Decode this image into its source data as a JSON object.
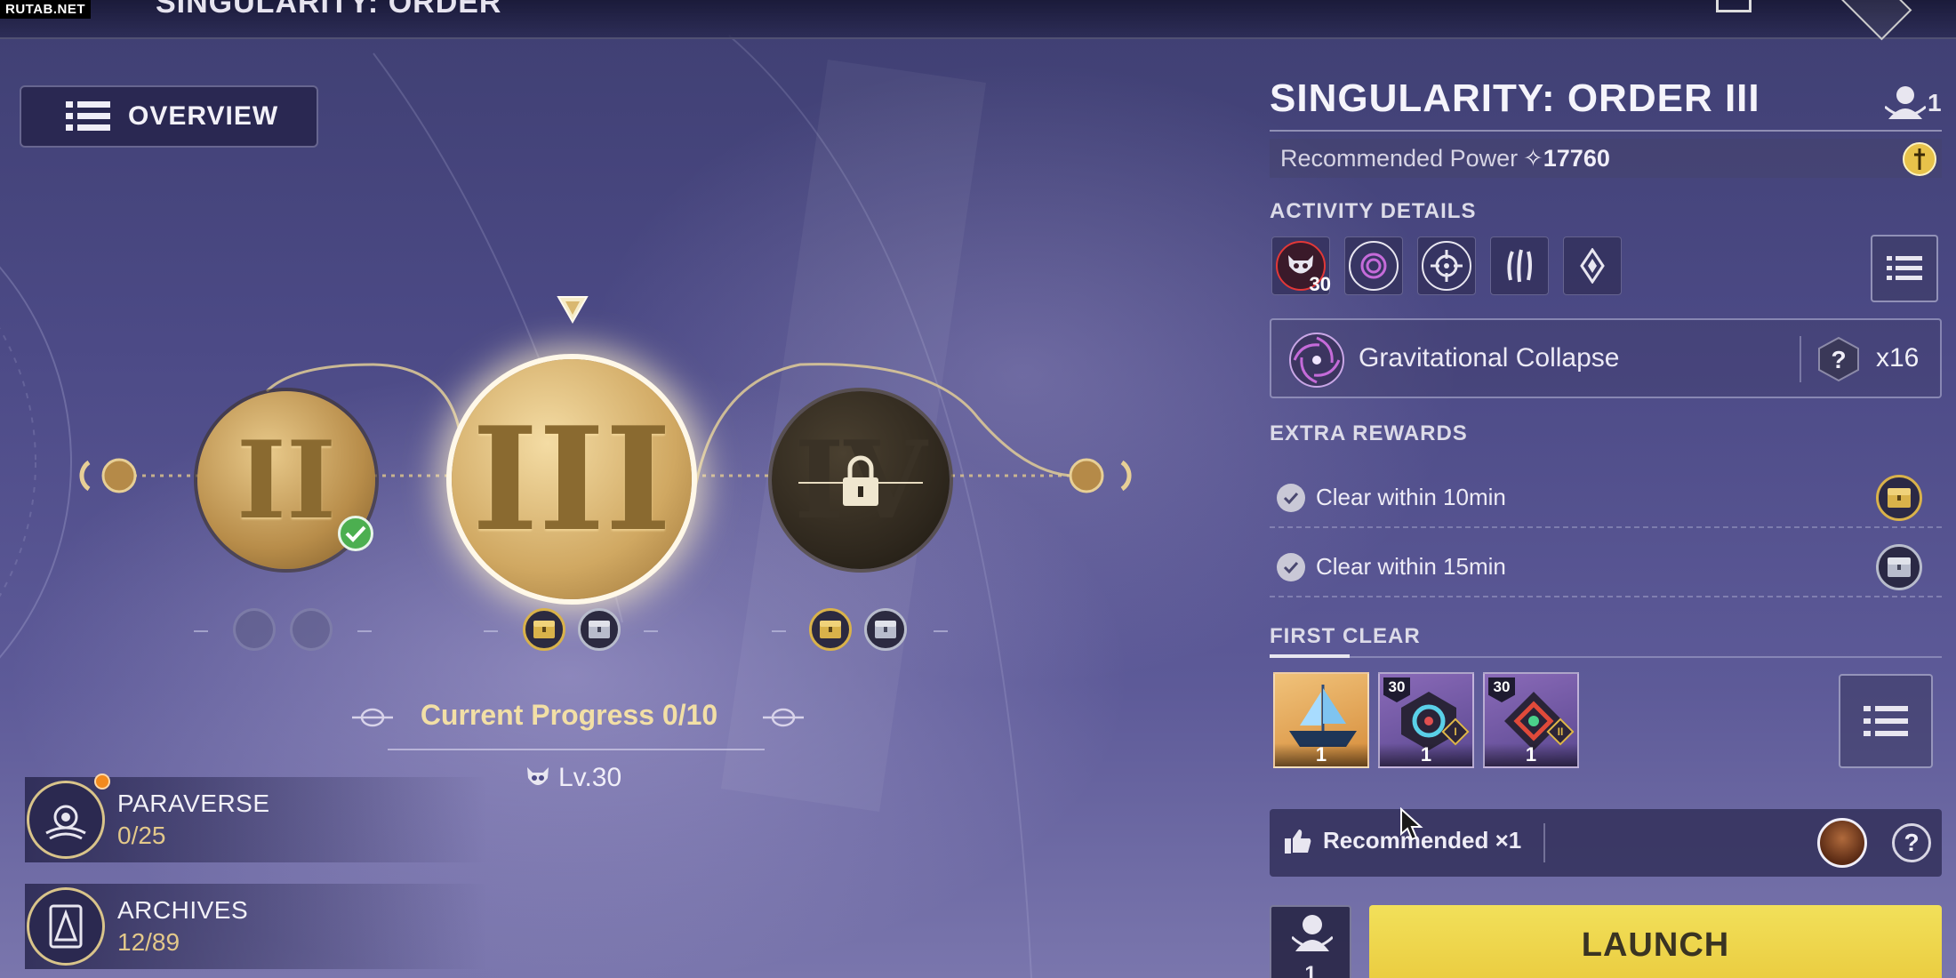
{
  "watermark": "RUTAB.NET",
  "top_bar": {
    "title": "SINGULARITY: ORDER"
  },
  "overview_button": {
    "label": "OVERVIEW"
  },
  "stages": [
    {
      "numeral": "II",
      "state": "cleared"
    },
    {
      "numeral": "III",
      "state": "selected"
    },
    {
      "numeral": "IV",
      "state": "locked"
    }
  ],
  "progress": {
    "label": "Current Progress 0/10",
    "level": "Lv.30"
  },
  "side_entries": [
    {
      "title": "PARAVERSE",
      "value": "0/25",
      "icon": "paraverse-icon"
    },
    {
      "title": "ARCHIVES",
      "value": "12/89",
      "icon": "archives-icon"
    }
  ],
  "panel": {
    "title": "SINGULARITY: ORDER III",
    "party_count": "1",
    "recommended_power_label": "Recommended Power",
    "recommended_power_value": "17760",
    "activity_details_label": "ACTIVITY DETAILS",
    "activity_icons": [
      "enemy-level-icon",
      "vortex-icon",
      "target-icon",
      "claw-icon",
      "shard-icon"
    ],
    "enemy_level": "30",
    "modifier_name": "Gravitational Collapse",
    "modifier_count": "x16",
    "extra_rewards_label": "EXTRA REWARDS",
    "extra_rewards": [
      {
        "text": "Clear within 10min",
        "chest": "gold"
      },
      {
        "text": "Clear within 15min",
        "chest": "silver"
      }
    ],
    "first_clear_label": "FIRST CLEAR",
    "first_clear_items": [
      {
        "qty": "1",
        "level": "",
        "tier": "",
        "icon": "ship-icon"
      },
      {
        "qty": "1",
        "level": "30",
        "tier": "I",
        "icon": "module-blue-icon"
      },
      {
        "qty": "1",
        "level": "30",
        "tier": "II",
        "icon": "module-red-icon"
      }
    ],
    "recommended_label": "Recommended ×1",
    "help": "?",
    "squad_count": "1",
    "launch_label": "LAUNCH"
  },
  "colors": {
    "accent_gold": "#e3c88a",
    "launch_yellow": "#f2e05a",
    "background": "#4c4a86"
  }
}
